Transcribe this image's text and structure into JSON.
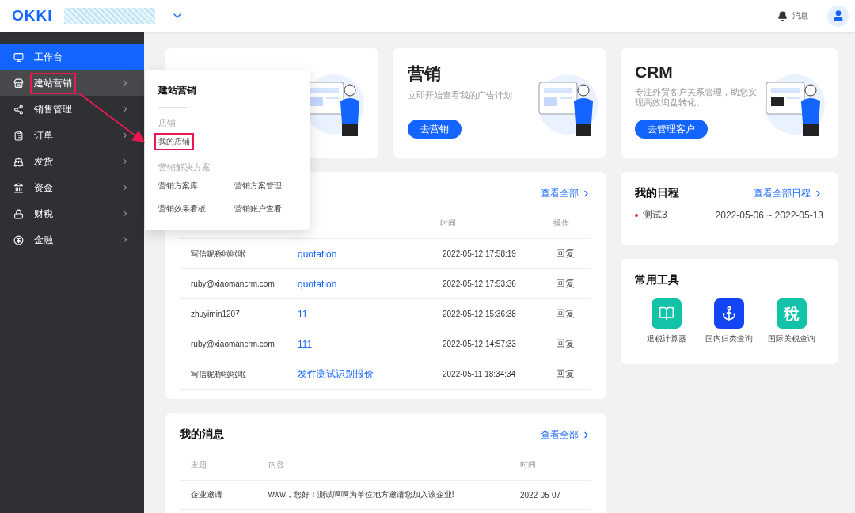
{
  "header": {
    "logo": "OKKI",
    "notifications": "消息"
  },
  "sidebar": {
    "items": [
      {
        "label": "工作台",
        "selected": true,
        "expanded": false,
        "submenu": false,
        "highlighted": false
      },
      {
        "label": "建站营销",
        "selected": false,
        "expanded": true,
        "submenu": true,
        "highlighted": true
      },
      {
        "label": "销售管理",
        "selected": false,
        "expanded": false,
        "submenu": true,
        "highlighted": false
      },
      {
        "label": "订单",
        "selected": false,
        "expanded": false,
        "submenu": true,
        "highlighted": false
      },
      {
        "label": "发货",
        "selected": false,
        "expanded": false,
        "submenu": true,
        "highlighted": false
      },
      {
        "label": "资金",
        "selected": false,
        "expanded": false,
        "submenu": true,
        "highlighted": false
      },
      {
        "label": "财税",
        "selected": false,
        "expanded": false,
        "submenu": true,
        "highlighted": false
      },
      {
        "label": "金融",
        "selected": false,
        "expanded": false,
        "submenu": true,
        "highlighted": false
      }
    ]
  },
  "flyout": {
    "title": "建站营销",
    "sections": [
      {
        "heading": "店铺",
        "items": [
          {
            "label": "我的店铺",
            "highlighted": true
          }
        ]
      },
      {
        "heading": "营销解决方案",
        "items": [
          {
            "label": "营销方案库",
            "highlighted": false
          },
          {
            "label": "营销方案管理",
            "highlighted": false
          },
          {
            "label": "营销效果看板",
            "highlighted": false
          },
          {
            "label": "营销账户查看",
            "highlighted": false
          }
        ]
      }
    ]
  },
  "promo_cards": [
    {
      "kind": "website"
    },
    {
      "kind": "marketing",
      "title": "营销",
      "subtitle": "立即开始查看我的广告计划",
      "button": "去营销"
    },
    {
      "kind": "crm",
      "title": "CRM",
      "subtitle": "专注外贸客户关系管理，助您实现高效询盘转化。",
      "button": "去管理客户"
    }
  ],
  "mail_card": {
    "link": "查看全部",
    "column_3": "时间",
    "column_4": "操作",
    "rows": [
      {
        "sender": "写信昵称啦啦啦",
        "subject": "quotation",
        "time": "2022-05-12 17:58:19",
        "action": "回复"
      },
      {
        "sender": "ruby@xiaomancrm.com",
        "subject": "quotation",
        "time": "2022-05-12 17:53:36",
        "action": "回复"
      },
      {
        "sender": "zhuyimin1207",
        "subject": "11",
        "time": "2022-05-12 15:36:38",
        "action": "回复"
      },
      {
        "sender": "ruby@xiaomancrm.com",
        "subject": "111",
        "time": "2022-05-12 14:57:33",
        "action": "回复"
      },
      {
        "sender": "写信昵称啦啦啦",
        "subject": "发件测试识别报价",
        "time": "2022-05-11 18:34:34",
        "action": "回复"
      }
    ]
  },
  "schedule": {
    "title": "我的日程",
    "link": "查看全部日程",
    "items": [
      {
        "title": "测试3",
        "range": "2022-05-06 ~ 2022-05-13",
        "color": "#f5222d"
      }
    ]
  },
  "tools": {
    "title": "常用工具",
    "items": [
      {
        "kind": "book",
        "label": "退税计算器",
        "color": "#12c2a9"
      },
      {
        "kind": "anchor",
        "label": "国内归类查询",
        "color": "#1445f5"
      },
      {
        "kind": "glyph",
        "glyph": "稅",
        "label": "国际关税查询",
        "color": "#12c2a9"
      }
    ]
  },
  "messages": {
    "title": "我的消息",
    "link": "查看全部",
    "columns": [
      "主题",
      "内容",
      "时间"
    ],
    "rows": [
      {
        "subject": "企业邀请",
        "content": "www，您好！测试啊啊为单位地方邀请您加入该企业!",
        "time": "2022-05-07"
      }
    ]
  }
}
